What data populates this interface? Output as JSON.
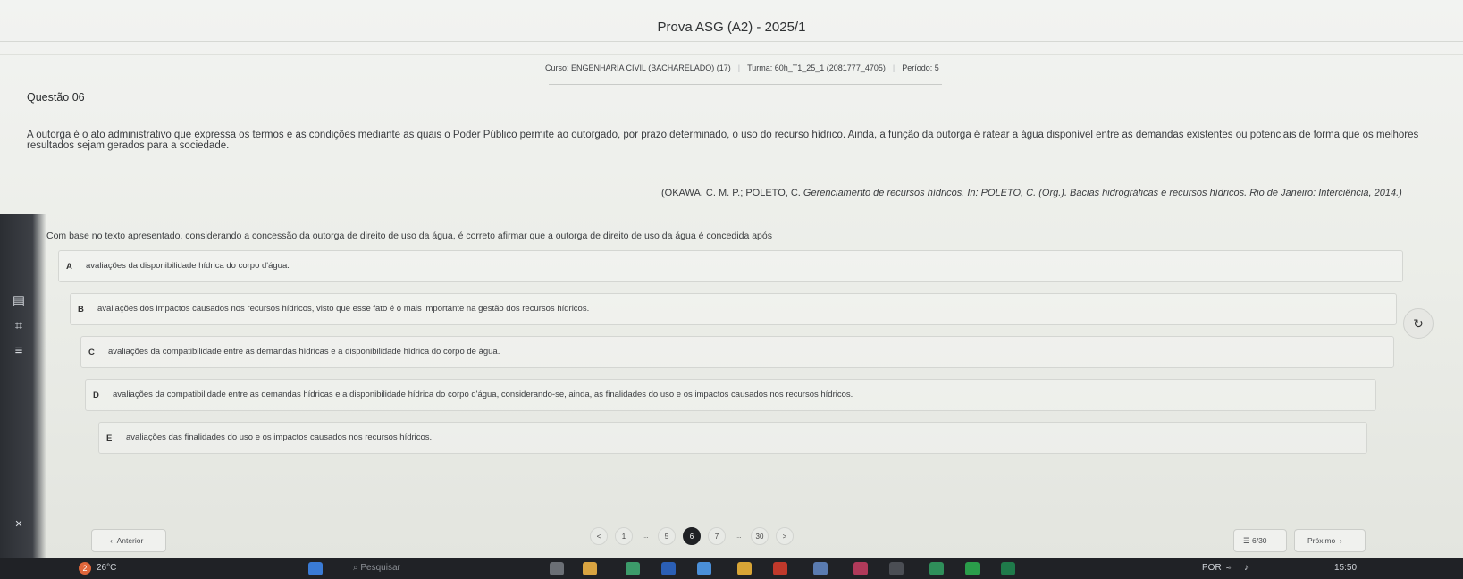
{
  "header": {
    "title": "Prova ASG (A2) - 2025/1",
    "course": "Curso: ENGENHARIA CIVIL (BACHARELADO) (17)",
    "class": "Turma: 60h_T1_25_1 (2081777_4705)",
    "period": "Período: 5"
  },
  "question": {
    "label": "Questão 06",
    "statement": "A outorga é o ato administrativo que expressa os termos e as condições mediante as quais o Poder Público permite ao outorgado, por prazo determinado, o uso do recurso hídrico. Ainda, a função da outorga é ratear a água disponível entre as demandas existentes ou potenciais de forma que os melhores resultados sejam gerados para a sociedade.",
    "citation_authors": "(OKAWA, C. M. P.; POLETO, C. ",
    "citation_title": "Gerenciamento de recursos hídricos. In: POLETO, C. (Org.). Bacias hidrográficas e recursos hídricos. Rio de Janeiro: Interciência, 2014.)",
    "prompt": "Com base no texto apresentado, considerando a concessão da outorga de direito de uso da água, é correto afirmar que a outorga de direito de uso da água é concedida após",
    "options": [
      {
        "letter": "A",
        "text": "avaliações da disponibilidade hídrica do corpo d'água."
      },
      {
        "letter": "B",
        "text": "avaliações dos impactos causados nos recursos hídricos, visto que esse fato é o mais importante na gestão dos recursos hídricos."
      },
      {
        "letter": "C",
        "text": "avaliações da compatibilidade entre as demandas hídricas e a disponibilidade hídrica do corpo de água."
      },
      {
        "letter": "D",
        "text": "avaliações da compatibilidade entre as demandas hídricas e a disponibilidade hídrica do corpo d'água, considerando-se, ainda, as finalidades do uso e os impactos causados nos recursos hídricos."
      },
      {
        "letter": "E",
        "text": "avaliações das finalidades do uso e os impactos causados nos recursos hídricos."
      }
    ]
  },
  "navigation": {
    "prev_label": "Anterior",
    "next_label": "Próximo",
    "counter": "6/30",
    "pages": [
      "<",
      "1",
      "...",
      "5",
      "6",
      "7",
      "...",
      "30",
      ">"
    ],
    "current_page": "6"
  },
  "taskbar": {
    "weather_badge": "2",
    "temperature": "26°C",
    "search_placeholder": "Pesquisar",
    "language": "POR",
    "clock": "15:50"
  },
  "colors": {
    "page_bg": "#eceee9",
    "taskbar_bg": "#202226",
    "active_page": "#1f2124"
  }
}
